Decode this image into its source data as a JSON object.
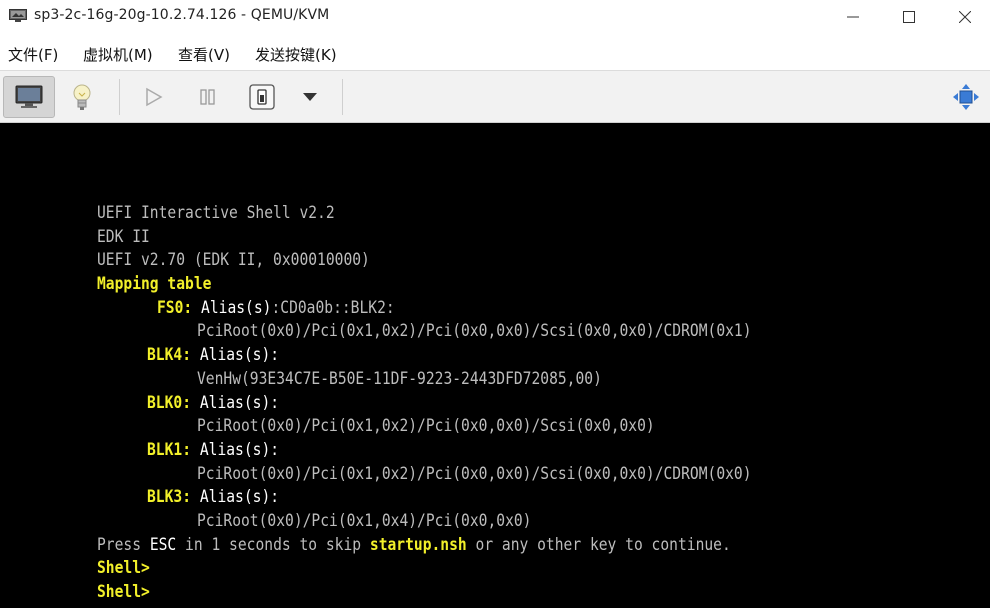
{
  "window": {
    "title": "sp3-2c-16g-20g-10.2.74.126 - QEMU/KVM",
    "icon": "monitor-app-icon",
    "controls": [
      "minimize-icon",
      "maximize-icon",
      "close-icon"
    ]
  },
  "menu": {
    "file": "文件(F)",
    "vm": "虚拟机(M)",
    "view": "查看(V)",
    "sendkey": "发送按键(K)"
  },
  "toolbar": {
    "buttons": [
      "console-monitor-icon",
      "details-lightbulb-icon",
      "run-play-icon",
      "pause-icon",
      "shutdown-icon",
      "dropdown-arrow-icon",
      "fullscreen-move-icon"
    ]
  },
  "console": {
    "l1": "UEFI Interactive Shell v2.2",
    "l2": "EDK II",
    "l3": "UEFI v2.70 (EDK II, 0x00010000)",
    "l4": "Mapping table",
    "fs0_name": "FS0:",
    "alias": "Alias(s)",
    "fs0_alias_rest": ":CD0a0b::BLK2:",
    "fs0_path": "PciRoot(0x0)/Pci(0x1,0x2)/Pci(0x0,0x0)/Scsi(0x0,0x0)/CDROM(0x1)",
    "blk4_name": "BLK4:",
    "blk4_alias_full": "Alias(s):",
    "blk4_path": "VenHw(93E34C7E-B50E-11DF-9223-2443DFD72085,00)",
    "blk0_name": "BLK0:",
    "blk0_alias_full": "Alias(s):",
    "blk0_path": "PciRoot(0x0)/Pci(0x1,0x2)/Pci(0x0,0x0)/Scsi(0x0,0x0)",
    "blk1_name": "BLK1:",
    "blk1_alias_full": "Alias(s):",
    "blk1_path": "PciRoot(0x0)/Pci(0x1,0x2)/Pci(0x0,0x0)/Scsi(0x0,0x0)/CDROM(0x0)",
    "blk3_name": "BLK3:",
    "blk3_alias_full": "Alias(s):",
    "blk3_path": "PciRoot(0x0)/Pci(0x1,0x4)/Pci(0x0,0x0)",
    "press_a": "Press ",
    "press_esc": "ESC",
    "press_b": " in 1 seconds to skip ",
    "press_file": "startup.nsh",
    "press_c": " or any other key to continue.",
    "prompt1": "Shell>",
    "prompt2": "Shell>"
  },
  "colors": {
    "console_bg": "#000000",
    "console_text": "#bdbdbd",
    "highlight_yellow": "#f2f02a",
    "bright_white": "#ffffff"
  }
}
